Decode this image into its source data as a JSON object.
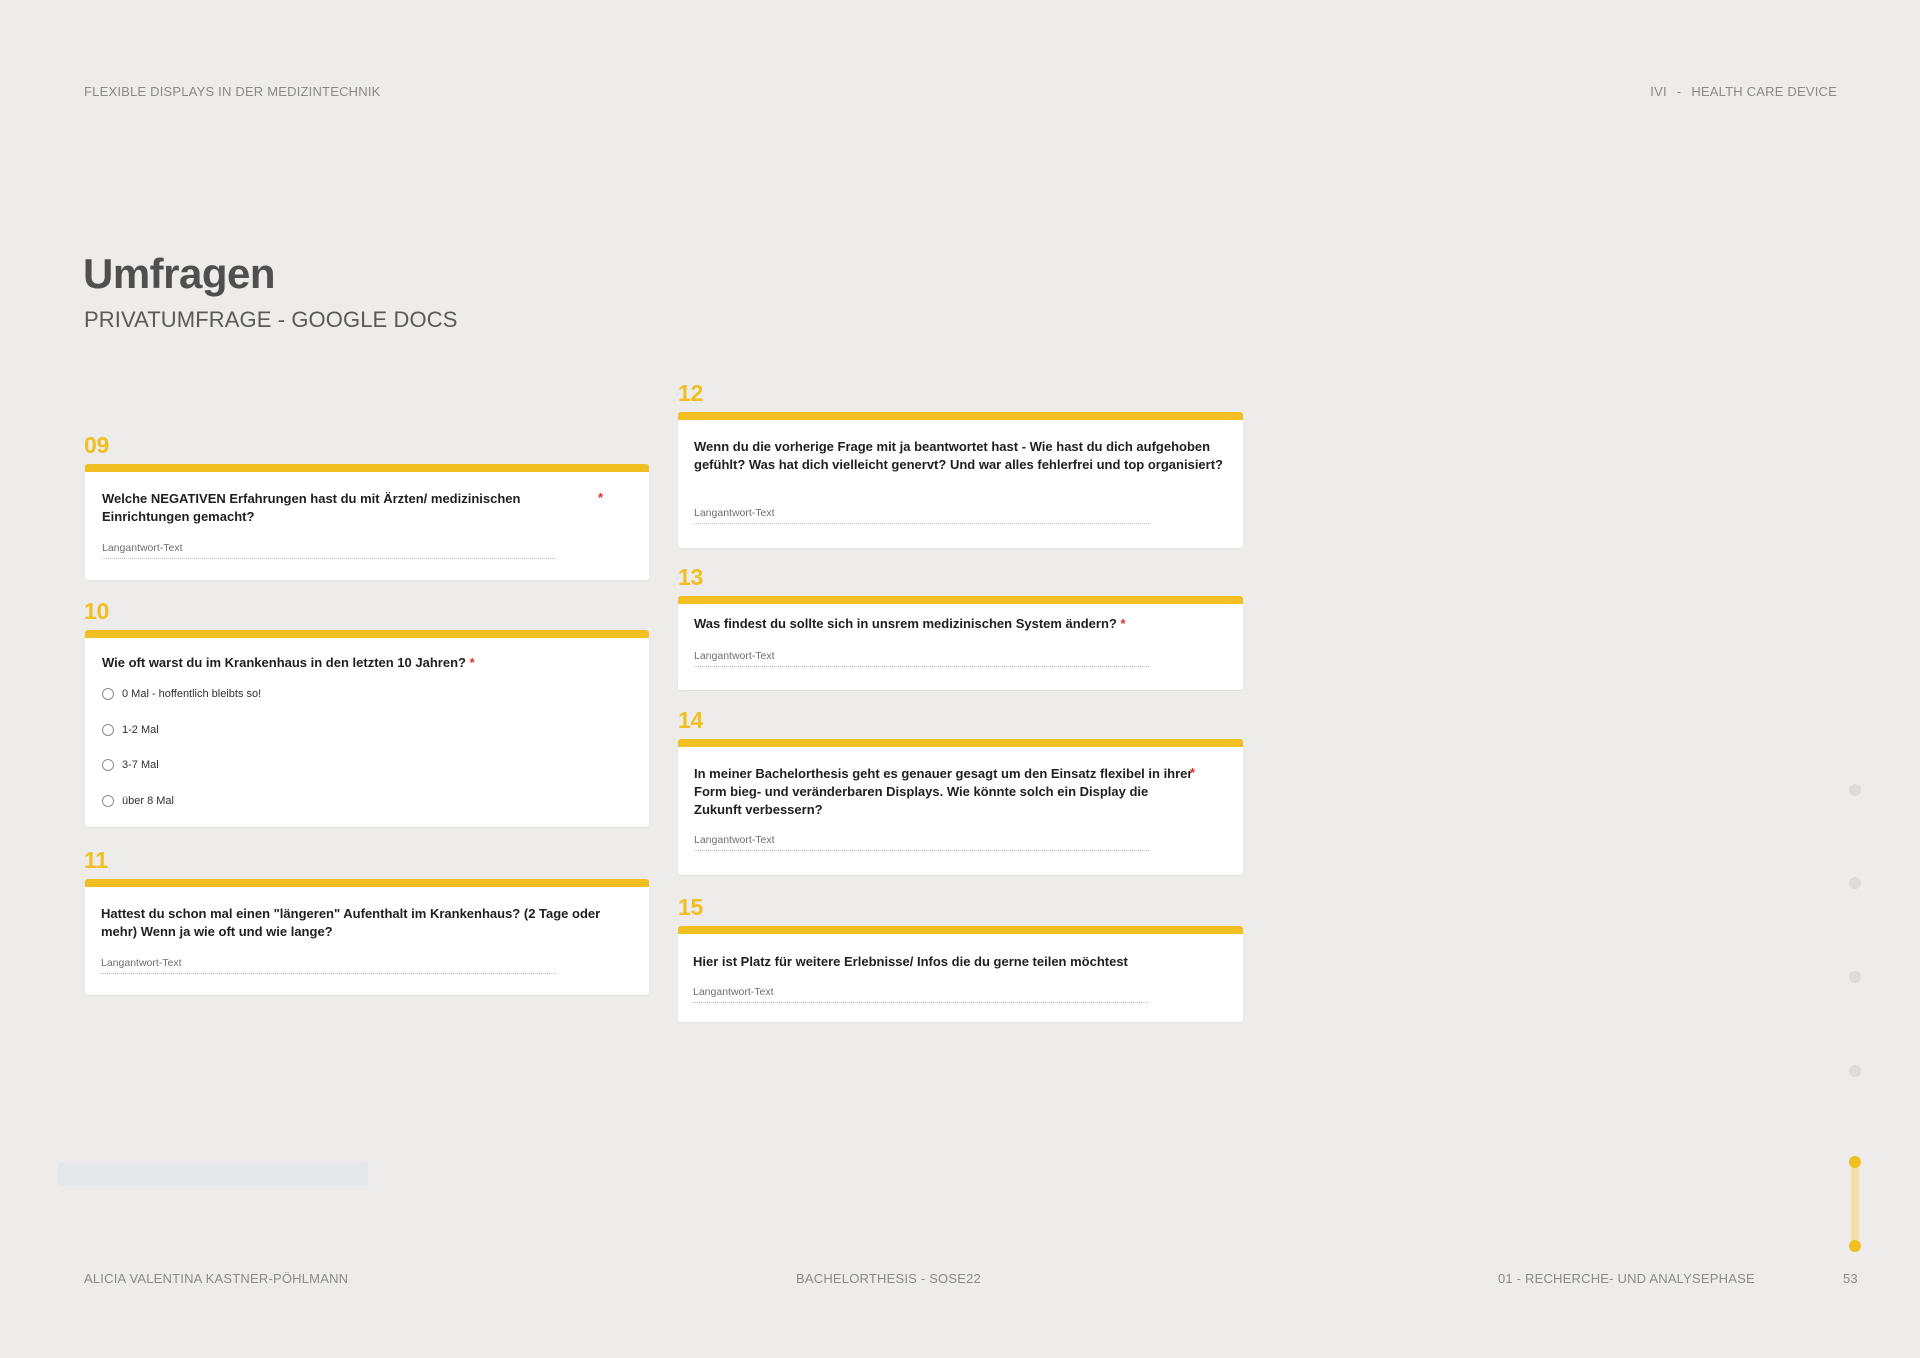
{
  "header": {
    "left": "FLEXIBLE DISPLAYS IN DER MEDIZINTECHNIK",
    "right_code": "IVI",
    "right_sep": "-",
    "right_label": "HEALTH CARE DEVICE"
  },
  "page": {
    "title": "Umfragen",
    "subtitle": "PRIVATUMFRAGE - GOOGLE DOCS"
  },
  "required_mark": "*",
  "questions": [
    {
      "number": "09",
      "text": "Welche NEGATIVEN Erfahrungen hast du mit Ärzten/  medizinischen Einrichtungen gemacht?",
      "placeholder": "Langantwort-Text"
    },
    {
      "number": "10",
      "text": "Wie oft warst du im Krankenhaus in den letzten 10 Jahren?",
      "options": [
        "0 Mal - hoffentlich bleibts so!",
        "1-2 Mal",
        "3-7 Mal",
        "über 8 Mal"
      ]
    },
    {
      "number": "11",
      "text": "Hattest du schon mal einen \"längeren\" Aufenthalt im Krankenhaus? (2 Tage oder mehr) Wenn ja wie oft und wie lange?",
      "placeholder": "Langantwort-Text"
    },
    {
      "number": "12",
      "text": "Wenn du die vorherige Frage mit ja beantwortet hast - Wie hast du dich aufgehoben gefühlt? Was hat dich vielleicht genervt? Und war alles fehlerfrei und top organisiert?",
      "placeholder": "Langantwort-Text"
    },
    {
      "number": "13",
      "text": "Was findest du sollte sich in unsrem medizinischen System ändern?",
      "placeholder": "Langantwort-Text"
    },
    {
      "number": "14",
      "text": "In meiner Bachelorthesis geht es genauer gesagt um den Einsatz flexibel in ihrer Form bieg- und veränderbaren Displays. Wie könnte solch ein Display die Zukunft verbessern?",
      "placeholder": "Langantwort-Text"
    },
    {
      "number": "15",
      "text": "Hier ist Platz für weitere Erlebnisse/ Infos die du gerne teilen möchtest",
      "placeholder": "Langantwort-Text"
    }
  ],
  "footer": {
    "author": "ALICIA VALENTINA KASTNER-PÖHLMANN",
    "center": "BACHELORTHESIS - SOSE22",
    "section": "01 - RECHERCHE- UND ANALYSEPHASE",
    "page_number": "53"
  },
  "colors": {
    "accent": "#f1bf22",
    "background": "#edecea",
    "required": "#d93025"
  }
}
